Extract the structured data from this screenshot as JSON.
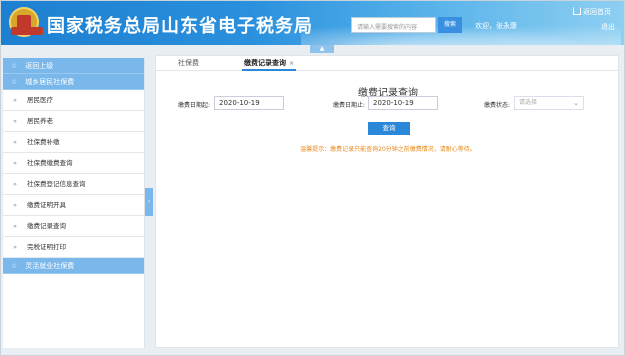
{
  "header": {
    "title": "国家税务总局山东省电子税务局",
    "search_placeholder": "请输入需要搜索的内容",
    "search_button": "搜索",
    "welcome": "欢迎，张永康",
    "home_link": "返回首页",
    "logout": "退出"
  },
  "sidebar": {
    "back": "返回上级",
    "section1": "城乡居民社保费",
    "items": [
      "居民医疗",
      "居民养老",
      "社保费补缴",
      "社保费缴费查询",
      "社保费登记信息查询",
      "缴费证明开具",
      "缴费记录查询",
      "完税证明打印"
    ],
    "section2": "灵活就业社保费"
  },
  "tabs": [
    {
      "label": "社保费"
    },
    {
      "label": "缴费记录查询"
    }
  ],
  "form": {
    "title": "缴费记录查询",
    "start_label": "缴费日期起:",
    "start_value": "2020-10-19",
    "end_label": "缴费日期止:",
    "end_value": "2020-10-19",
    "status_label": "缴费状态:",
    "status_placeholder": "请选择",
    "query_button": "查询",
    "tip": "温馨提示：缴费记录只能查询20分钟之前缴费情况，请耐心等待。"
  },
  "colors": {
    "accent": "#2b88d8",
    "sidebar_head": "#7ab7ea",
    "tip": "#e8891b"
  }
}
